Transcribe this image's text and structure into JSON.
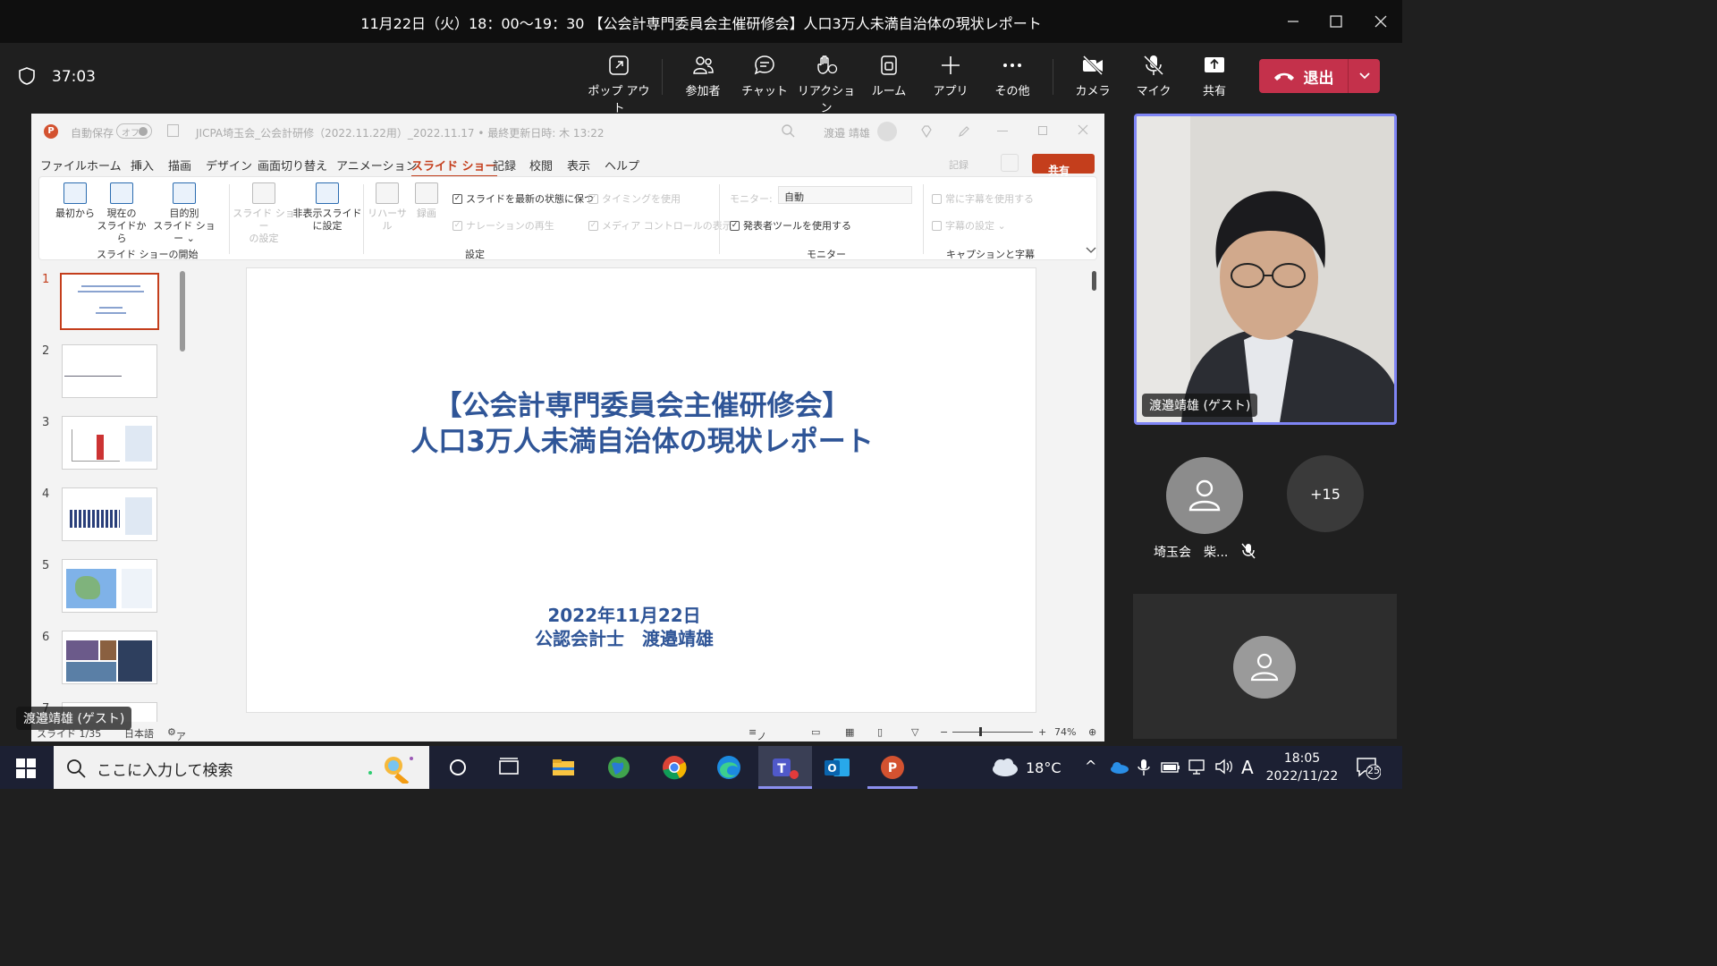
{
  "window": {
    "title": "11月22日（火）18：00～19：30 【公会計専門委員会主催研修会】人口3万人未満自治体の現状レポート"
  },
  "toolbar": {
    "timer": "37:03",
    "popout": "ポップ アウト",
    "participants": "参加者",
    "chat": "チャット",
    "reaction": "リアクション",
    "rooms": "ルーム",
    "apps": "アプリ",
    "more": "その他",
    "camera": "カメラ",
    "mic": "マイク",
    "share": "共有",
    "leave": "退出"
  },
  "powerpoint": {
    "autosave": "自動保存",
    "autosave_state": "オフ",
    "doc_title": "JICPA埼玉会_公会計研修（2022.11.22用）_2022.11.17 • 最終更新日時: 木 13:22",
    "user": "渡邉 靖雄",
    "menu": [
      "ファイル",
      "ホーム",
      "挿入",
      "描画",
      "デザイン",
      "画面切り替え",
      "アニメーション",
      "スライド ショー",
      "記録",
      "校閲",
      "表示",
      "ヘルプ"
    ],
    "active_tab": "スライド ショー",
    "record_btn": "記録",
    "share_btn": "共有",
    "ribbon": {
      "from_beginning": "最初から",
      "from_current_1": "現在の",
      "from_current_2": "スライドから",
      "custom_1": "目的別",
      "custom_2": "スライド ショー ⌄",
      "setup_1": "スライド ショー",
      "setup_2": "の設定",
      "hide_1": "非表示スライド",
      "hide_2": "に設定",
      "rehearse": "リハーサル",
      "record": "録画",
      "keep_updated": "スライドを最新の状態に保つ",
      "use_timings": "タイミングを使用",
      "play_narration": "ナレーションの再生",
      "show_media": "メディア コントロールの表示",
      "monitor_label": "モニター:",
      "monitor_value": "自動",
      "presenter_view": "発表者ツールを使用する",
      "always_captions": "常に字幕を使用する",
      "caption_settings": "字幕の設定 ⌄",
      "group_start": "スライド ショーの開始",
      "group_setup": "設定",
      "group_monitor": "モニター",
      "group_captions": "キャプションと字幕"
    },
    "thumbnails": [
      "1",
      "2",
      "3",
      "4",
      "5",
      "6",
      "7"
    ],
    "slide": {
      "title_line1": "【公会計専門委員会主催研修会】",
      "title_line2": "人口3万人未満自治体の現状レポート",
      "date": "2022年11月22日",
      "author": "公認会計士　渡邉靖雄"
    },
    "status": {
      "slide": "スライド 1/35",
      "language": "日本語",
      "accessibility": "アクセシビリティ: 検討が必要です",
      "notes": "ノート",
      "zoom": "74%"
    },
    "presenter_label": "渡邉靖雄 (ゲスト)"
  },
  "participants": {
    "main_video_name": "渡邉靖雄 (ゲスト)",
    "p2_name": "埼玉会　柴...",
    "more_count": "+15"
  },
  "taskbar": {
    "search_placeholder": "ここに入力して検索",
    "weather": "18°C",
    "ime": "A",
    "time": "18:05",
    "date": "2022/11/22",
    "notifications": "25"
  }
}
